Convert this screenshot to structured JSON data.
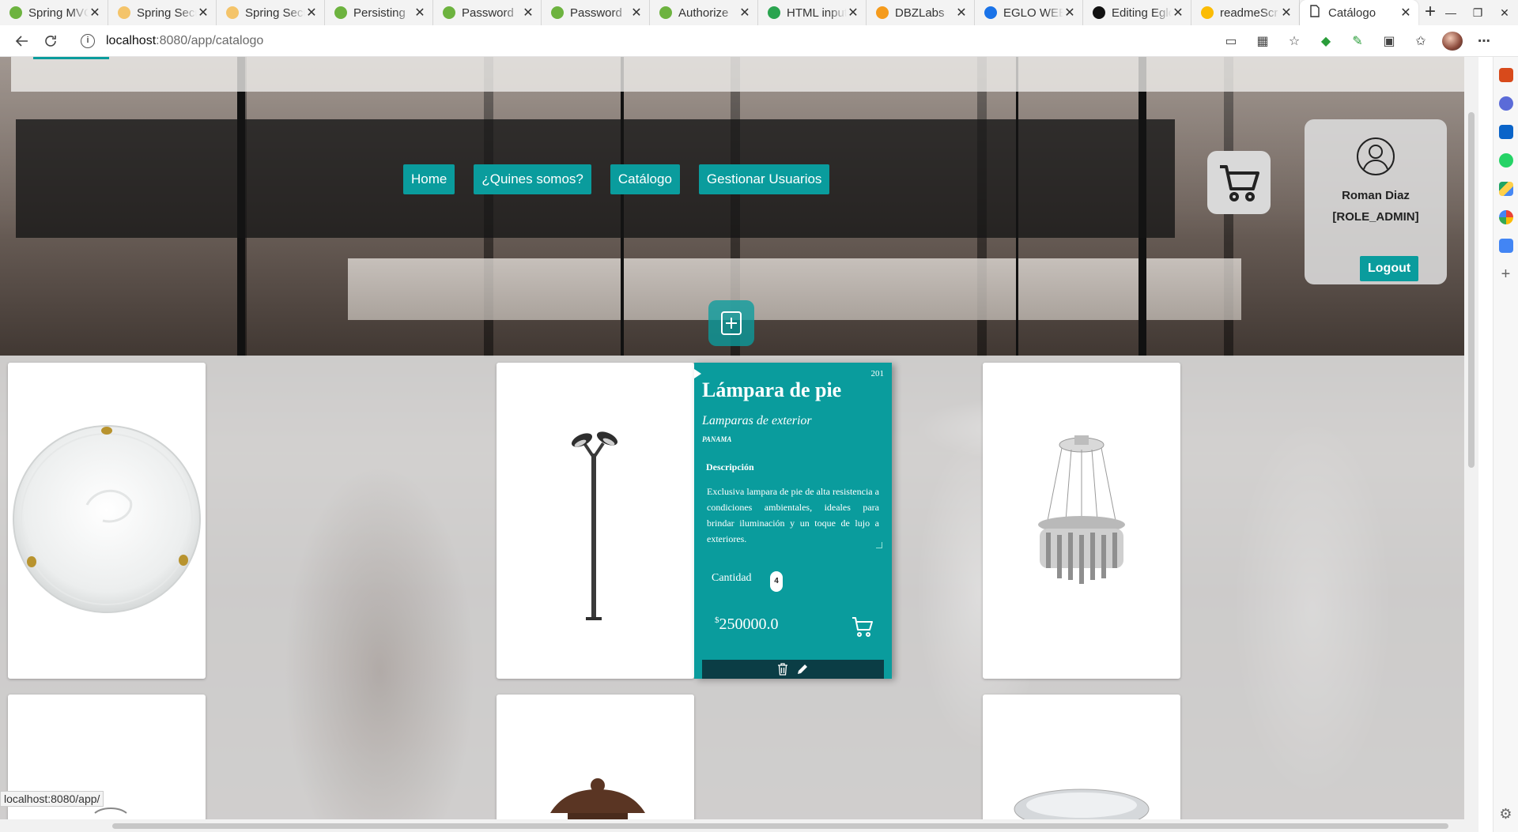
{
  "browser": {
    "tabs": [
      {
        "title": "Spring MVC",
        "color": "#6db33f"
      },
      {
        "title": "Spring Security",
        "color": "#f4c46a"
      },
      {
        "title": "Spring Security",
        "color": "#f4c46a"
      },
      {
        "title": "Persisting",
        "color": "#6db33f"
      },
      {
        "title": "Password",
        "color": "#6db33f"
      },
      {
        "title": "Password",
        "color": "#6db33f"
      },
      {
        "title": "Authorize",
        "color": "#6db33f"
      },
      {
        "title": "HTML input",
        "color": "#2aa44f"
      },
      {
        "title": "DBZLabs",
        "color": "#f59b1c"
      },
      {
        "title": "EGLO WEB",
        "color": "#1a73e8"
      },
      {
        "title": "Editing Eglo",
        "color": "#111111"
      },
      {
        "title": "readmeScr",
        "color": "#fbbc04"
      }
    ],
    "active_tab": "Catálogo",
    "url_host": "localhost",
    "url_path": ":8080/app/catalogo",
    "status_url": "localhost:8080/app/"
  },
  "nav": {
    "items": [
      "Home",
      "¿Quines somos?",
      "Catálogo",
      "Gestionar Usuarios"
    ]
  },
  "user": {
    "name": "Roman Diaz",
    "role": "[ROLE_ADMIN]",
    "logout_label": "Logout"
  },
  "product": {
    "code": "201",
    "name": "Lámpara de pie",
    "category": "Lamparas de exterior",
    "brand": "PANAMA",
    "description_label": "Descripción",
    "description": "Exclusiva lampara de pie de alta resistencia a condiciones ambientales, ideales para brindar iluminación y un toque de lujo a exteriores.",
    "quantity_label": "Cantidad",
    "quantity": "4",
    "currency": "$",
    "price": "250000.0"
  },
  "colors": {
    "accent": "#0a9c9d",
    "action_bar": "#0b3d45"
  }
}
